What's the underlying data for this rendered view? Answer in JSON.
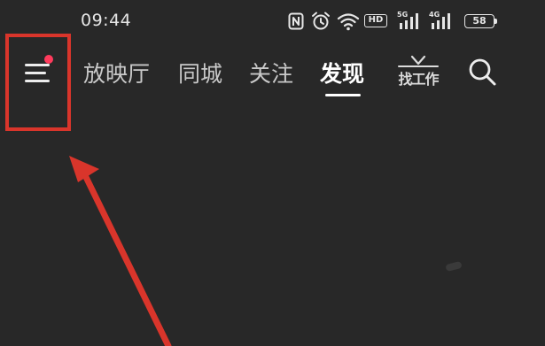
{
  "status_bar": {
    "time": "09:44",
    "hd_label": "HD",
    "sig5_label": "5G",
    "sig4_label": "4G",
    "battery": "58",
    "icons": [
      "nfc-icon",
      "alarm-icon",
      "wifi-icon",
      "hd-icon",
      "signal-5g-icon",
      "signal-4g-icon",
      "battery-icon"
    ]
  },
  "nav": {
    "menu_icon": "menu-icon",
    "tabs": [
      {
        "label": "放映厅",
        "active": false
      },
      {
        "label": "同城",
        "active": false
      },
      {
        "label": "关注",
        "active": false
      },
      {
        "label": "发现",
        "active": true
      }
    ],
    "job_tab_label": "找工作",
    "search_icon": "search-icon"
  },
  "colors": {
    "background": "#282828",
    "notify_dot": "#ff3b5c",
    "annotation": "#d9352b"
  }
}
